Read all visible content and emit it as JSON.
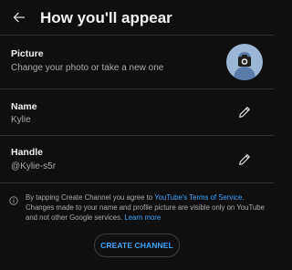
{
  "header": {
    "title": "How you'll appear",
    "back_icon": "arrow-left-icon"
  },
  "picture": {
    "label": "Picture",
    "subtitle": "Change your photo or take a new one",
    "avatar_icon": "camera-icon",
    "avatar_color": "#9cb6d6"
  },
  "name": {
    "label": "Name",
    "value": "Kylie",
    "edit_icon": "pencil-icon"
  },
  "handle": {
    "label": "Handle",
    "value": "@Kylie-s5r",
    "edit_icon": "pencil-icon"
  },
  "info": {
    "icon": "info-icon",
    "text_before": "By tapping Create Channel you agree to ",
    "terms_link": "YouTube's Terms of Service",
    "text_after": ". Changes made to your name and profile picture are visible only on YouTube and not other Google services. ",
    "learn_more": "Learn more"
  },
  "actions": {
    "create_label": "CREATE CHANNEL"
  },
  "colors": {
    "background": "#0f0f0f",
    "accent": "#3ea6ff",
    "secondary_text": "#aaaaaa"
  }
}
